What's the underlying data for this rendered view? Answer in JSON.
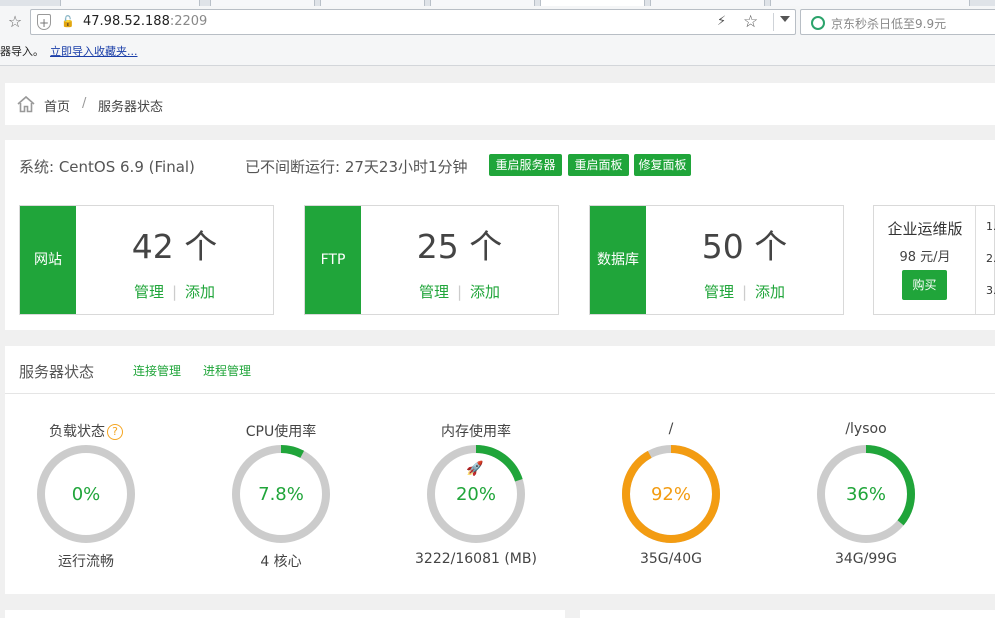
{
  "browser": {
    "url_host": "47.98.52.188",
    "url_port": ":2209",
    "search_placeholder": "京东秒杀日低至9.9元",
    "infobar_text": "器导入。",
    "infobar_link": "立即导入收藏夹..."
  },
  "breadcrumb": {
    "home": "首页",
    "separator": "/",
    "current": "服务器状态"
  },
  "system": {
    "os": "系统: CentOS 6.9 (Final)",
    "uptime": "已不间断运行: 27天23小时1分钟",
    "buttons": {
      "restart_server": "重启服务器",
      "restart_panel": "重启面板",
      "repair_panel": "修复面板"
    }
  },
  "cards": [
    {
      "label": "网站",
      "count": "42 个",
      "manage": "管理",
      "add": "添加"
    },
    {
      "label": "FTP",
      "count": "25 个",
      "manage": "管理",
      "add": "添加"
    },
    {
      "label": "数据库",
      "count": "50 个",
      "manage": "管理",
      "add": "添加"
    }
  ],
  "enterprise": {
    "title": "企业运维版",
    "price": "98 元/月",
    "buy": "购买",
    "list": [
      "1.",
      "2.",
      "3."
    ]
  },
  "status": {
    "title": "服务器状态",
    "link_connections": "连接管理",
    "link_processes": "进程管理",
    "gauges": [
      {
        "title": "负载状态",
        "value": 0,
        "label": "0%",
        "sub": "运行流畅",
        "color": "#20a53a",
        "help": "?"
      },
      {
        "title": "CPU使用率",
        "value": 7.8,
        "label": "7.8%",
        "sub": "4 核心",
        "color": "#20a53a"
      },
      {
        "title": "内存使用率",
        "value": 20,
        "label": "20%",
        "sub": "3222/16081 (MB)",
        "color": "#20a53a",
        "icon": "rocket-icon"
      },
      {
        "title": "/",
        "value": 92,
        "label": "92%",
        "sub": "35G/40G",
        "color": "#f39c12"
      },
      {
        "title": "/lysoo",
        "value": 36,
        "label": "36%",
        "sub": "34G/99G",
        "color": "#20a53a"
      }
    ]
  }
}
